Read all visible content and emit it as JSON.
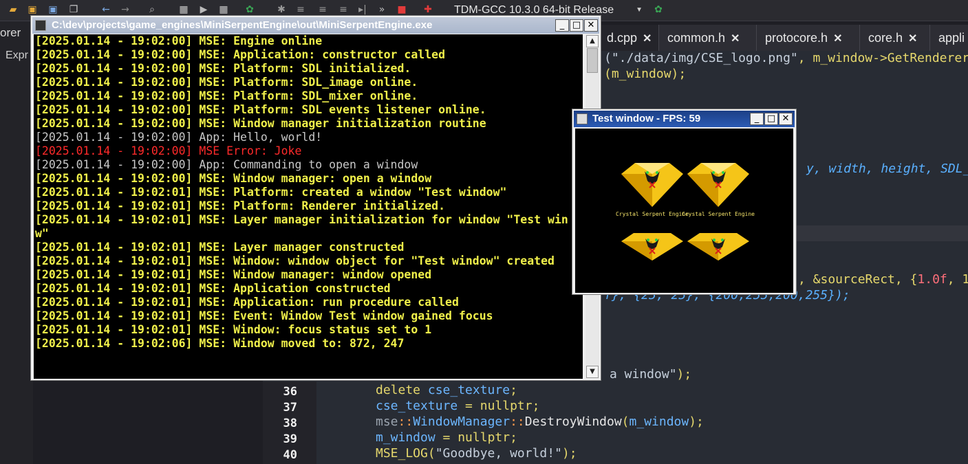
{
  "toolbar": {
    "compiler": "TDM-GCC 10.3.0 64-bit Release",
    "icons": [
      "open-file-icon",
      "save-icon",
      "save-as-icon",
      "save-all-icon",
      "undo-icon",
      "redo-icon",
      "find-icon",
      "compile-icon",
      "run-icon",
      "compile-run-icon",
      "rebuild-icon",
      "debug-icon",
      "indent-icon",
      "unindent-icon",
      "step-icon",
      "continue-icon",
      "stop-icon",
      "bookmark-icon",
      "settings-icon"
    ]
  },
  "left_panel": {
    "label_top": "orer",
    "label_sub": "Expr"
  },
  "tabs": [
    {
      "label": "d.cpp"
    },
    {
      "label": "common.h"
    },
    {
      "label": "protocore.h"
    },
    {
      "label": "core.h"
    },
    {
      "label": "appli"
    }
  ],
  "editor": {
    "fragments": {
      "line_a_str": "(\"./data/img/CSE_logo.png\"",
      "line_a_rest": ", m_window->GetRenderer",
      "line_b": "(m_window);",
      "line_c": "y, width, height, SDL_",
      "line_d_1": ", &sourceRect, {",
      "line_d_2": "1.0f",
      "line_d_3": ", 1",
      "line_e": "f}, {25, 25}, {200,255,200,255});",
      "line_f_str": "a window\"",
      "line_f_rest": ");"
    },
    "lines": [
      {
        "num": "36",
        "parts": [
          "delete ",
          "cse_texture",
          ";"
        ]
      },
      {
        "num": "37",
        "parts": [
          "cse_texture",
          " = ",
          "nullptr",
          ";"
        ]
      },
      {
        "num": "38",
        "parts": [
          "mse",
          "::",
          "WindowManager",
          "::",
          "DestroyWindow",
          "(",
          "m_window",
          ");"
        ]
      },
      {
        "num": "39",
        "parts": [
          "m_window",
          " = ",
          "nullptr",
          ";"
        ]
      },
      {
        "num": "40",
        "parts": [
          "MSE_LOG",
          "(",
          "\"Goodbye, world!\"",
          ");"
        ]
      }
    ]
  },
  "console": {
    "title": "C:\\dev\\projects\\game_engines\\MiniSerpentEngine\\out\\MiniSerpentEngine.exe",
    "lines": [
      {
        "kind": "mse",
        "text": "[2025.01.14 - 19:02:00] MSE: Engine online"
      },
      {
        "kind": "mse",
        "text": "[2025.01.14 - 19:02:00] MSE: Application: constructor called"
      },
      {
        "kind": "mse",
        "text": "[2025.01.14 - 19:02:00] MSE: Platform: SDL initialized."
      },
      {
        "kind": "mse",
        "text": "[2025.01.14 - 19:02:00] MSE: Platform: SDL_image online."
      },
      {
        "kind": "mse",
        "text": "[2025.01.14 - 19:02:00] MSE: Platform: SDL_mixer online."
      },
      {
        "kind": "mse",
        "text": "[2025.01.14 - 19:02:00] MSE: Platform: SDL events listener online."
      },
      {
        "kind": "mse",
        "text": "[2025.01.14 - 19:02:00] MSE: Window manager initialization routine"
      },
      {
        "kind": "app",
        "text": "[2025.01.14 - 19:02:00] App: Hello, world!"
      },
      {
        "kind": "err",
        "text": "[2025.01.14 - 19:02:00] MSE Error: Joke"
      },
      {
        "kind": "app",
        "text": "[2025.01.14 - 19:02:00] App: Commanding to open a window"
      },
      {
        "kind": "mse",
        "text": "[2025.01.14 - 19:02:00] MSE: Window manager: open a window"
      },
      {
        "kind": "mse",
        "text": "[2025.01.14 - 19:02:01] MSE: Platform: created a window \"Test window\""
      },
      {
        "kind": "mse",
        "text": "[2025.01.14 - 19:02:01] MSE: Platform: Renderer initialized."
      },
      {
        "kind": "mse",
        "text": "[2025.01.14 - 19:02:01] MSE: Layer manager initialization for window \"Test win"
      },
      {
        "kind": "mse",
        "text": "w\""
      },
      {
        "kind": "mse",
        "text": "[2025.01.14 - 19:02:01] MSE: Layer manager constructed"
      },
      {
        "kind": "mse",
        "text": "[2025.01.14 - 19:02:01] MSE: Window: window object for \"Test window\" created"
      },
      {
        "kind": "mse",
        "text": "[2025.01.14 - 19:02:01] MSE: Window manager: window opened"
      },
      {
        "kind": "mse",
        "text": "[2025.01.14 - 19:02:01] MSE: Application constructed"
      },
      {
        "kind": "mse",
        "text": "[2025.01.14 - 19:02:01] MSE: Application: run procedure called"
      },
      {
        "kind": "mse",
        "text": "[2025.01.14 - 19:02:01] MSE: Event: Window Test window gained focus"
      },
      {
        "kind": "mse",
        "text": "[2025.01.14 - 19:02:01] MSE: Window: focus status set to 1"
      },
      {
        "kind": "mse",
        "text": "[2025.01.14 - 19:02:06] MSE: Window moved to: 872, 247"
      }
    ]
  },
  "test_window": {
    "title": "Test window - FPS: 59",
    "logo_caption": "Crystal Serpent Engine",
    "colors": {
      "gem": "#f5c518",
      "gem_light": "#ffe680",
      "gem_dark": "#d49a00",
      "mark": "#d8201a"
    }
  },
  "window_buttons": {
    "minimize": "_",
    "maximize": "□",
    "close": "✕"
  }
}
